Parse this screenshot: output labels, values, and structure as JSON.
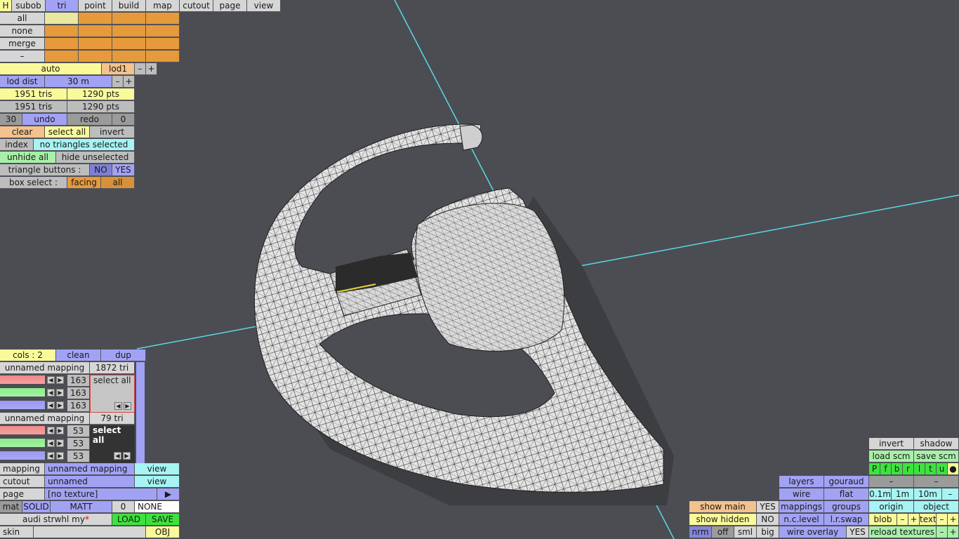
{
  "menu": {
    "h": "H",
    "items": [
      "subob",
      "tri",
      "point",
      "build",
      "map",
      "cutout",
      "page",
      "view"
    ]
  },
  "selection": {
    "all": "all",
    "none": "none",
    "merge": "merge",
    "minus": "–"
  },
  "lod": {
    "auto": "auto",
    "lod1": "lod1",
    "minus": "–",
    "plus": "+",
    "lod_dist_label": "lod dist",
    "lod_dist_value": "30 m",
    "tris1": "1951 tris",
    "pts1": "1290 pts",
    "tris2": "1951 tris",
    "pts2": "1290 pts"
  },
  "history": {
    "count": "30",
    "undo": "undo",
    "redo": "redo",
    "redo_count": "0"
  },
  "edit": {
    "clear": "clear",
    "select_all": "select all",
    "invert": "invert",
    "index": "index",
    "status": "no triangles selected",
    "unhide_all": "unhide all",
    "hide_unselected": "hide unselected",
    "triangle_buttons": "triangle buttons :",
    "no": "NO",
    "yes": "YES",
    "box_select": "box select :",
    "facing": "facing",
    "all": "all"
  },
  "mappings_panel": {
    "cols": "cols : 2",
    "clean": "clean",
    "dup": "dup",
    "mapping1": {
      "name": "unnamed mapping",
      "tri": "1872 tri",
      "v1": "163",
      "v2": "163",
      "v3": "163",
      "select_all": "select all"
    },
    "mapping2": {
      "name": "unnamed mapping",
      "tri": "79 tri",
      "v1": "53",
      "v2": "53",
      "v3": "53",
      "select_all": "select all"
    }
  },
  "props": {
    "mapping_label": "mapping",
    "mapping_value": "unnamed mapping",
    "mapping_view": "view",
    "cutout_label": "cutout",
    "cutout_value": "unnamed",
    "cutout_view": "view",
    "page_label": "page",
    "page_value": "[no texture]",
    "page_arrow": "▶",
    "mat": "mat",
    "solid": "SOLID",
    "matt": "MATT",
    "zero": "0",
    "none": "NONE",
    "file": "audi strwhl my",
    "star": "*",
    "load": "LOAD",
    "save": "SAVE",
    "skin": "skin",
    "obj": "OBJ"
  },
  "right_panel": {
    "invert": "invert",
    "shadow": "shadow",
    "load_scm": "load scm",
    "save_scm": "save scm",
    "flags": [
      "P",
      "f",
      "b",
      "r",
      "l",
      "t",
      "u",
      "●"
    ],
    "layers": "layers",
    "gouraud": "gouraud",
    "minus": "–",
    "wire": "wire",
    "flat": "flat",
    "d1": "0.1m",
    "d2": "1m",
    "d3": "10m",
    "show_main": "show main",
    "show_main_val": "YES",
    "mappings": "mappings",
    "groups": "groups",
    "origin": "origin",
    "object": "object",
    "show_hidden": "show hidden",
    "show_hidden_val": "NO",
    "nc_level": "n.c.level",
    "lr_swap": "l.r.swap",
    "blob": "blob",
    "text": "text",
    "plus": "+",
    "nrm": "nrm",
    "off": "off",
    "sml": "sml",
    "big": "big",
    "wire_overlay": "wire overlay",
    "wire_overlay_val": "YES",
    "reload_textures": "reload textures"
  }
}
